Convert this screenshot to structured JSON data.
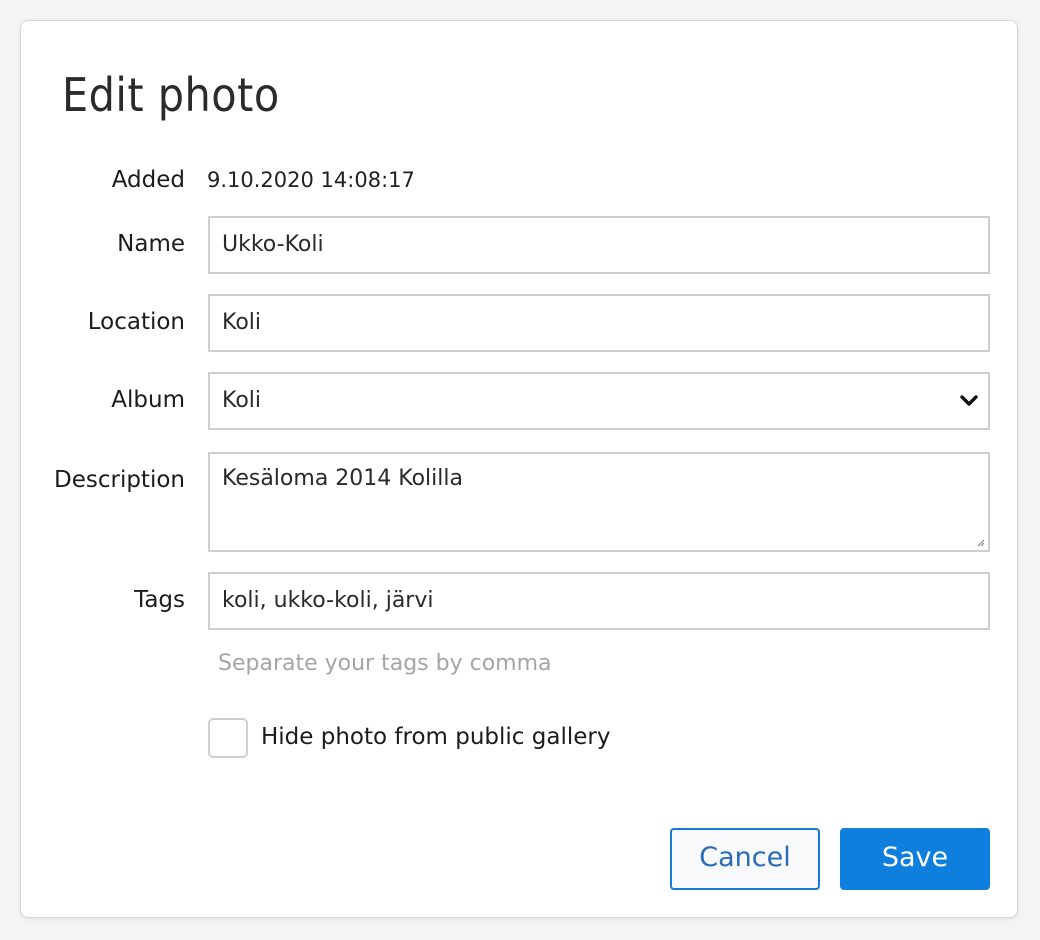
{
  "dialog": {
    "title": "Edit photo"
  },
  "fields": {
    "added": {
      "label": "Added",
      "value": "9.10.2020 14:08:17"
    },
    "name": {
      "label": "Name",
      "value": "Ukko-Koli"
    },
    "location": {
      "label": "Location",
      "value": "Koli"
    },
    "album": {
      "label": "Album",
      "value": "Koli",
      "icon": "chevron-down-icon"
    },
    "description": {
      "label": "Description",
      "value": "Kesäloma 2014 Kolilla"
    },
    "tags": {
      "label": "Tags",
      "value": "koli, ukko-koli, järvi",
      "hint": "Separate your tags by comma"
    }
  },
  "privacy": {
    "checkbox_label": "Hide photo from public gallery",
    "checked": false
  },
  "buttons": {
    "cancel_label": "Cancel",
    "save_label": "Save"
  },
  "colors": {
    "accent": "#0f7fde",
    "border": "#cfcfcf",
    "hint": "#a5a5a5"
  }
}
